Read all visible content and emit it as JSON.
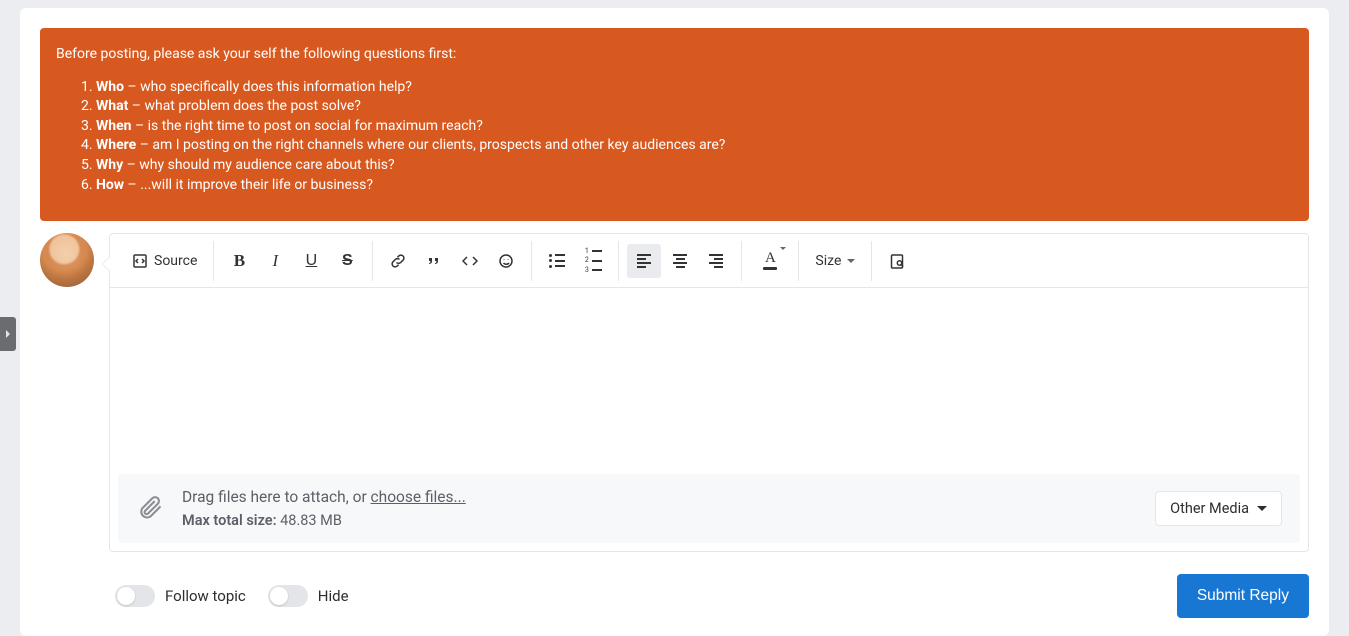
{
  "guidelines": {
    "intro": "Before posting, please ask your self the following questions first:",
    "items": [
      {
        "key": "Who",
        "text": " – who specifically does this information help?"
      },
      {
        "key": "What",
        "text": " – what problem does the post solve?"
      },
      {
        "key": "When",
        "text": " – is the right time to post on social for maximum reach?"
      },
      {
        "key": "Where",
        "text": " – am I posting on the right channels where our clients, prospects and other key audiences are?"
      },
      {
        "key": "Why",
        "text": " – why should my audience care about this?"
      },
      {
        "key": "How",
        "text": " – ...will it improve their life or business?"
      }
    ]
  },
  "toolbar": {
    "source": "Source",
    "size": "Size"
  },
  "attach": {
    "drag_text": "Drag files here to attach, or ",
    "choose": "choose files...",
    "max_label": "Max total size:",
    "max_value": " 48.83 MB",
    "other_media": "Other Media"
  },
  "footer": {
    "follow": "Follow topic",
    "hide": "Hide",
    "submit": "Submit Reply"
  }
}
